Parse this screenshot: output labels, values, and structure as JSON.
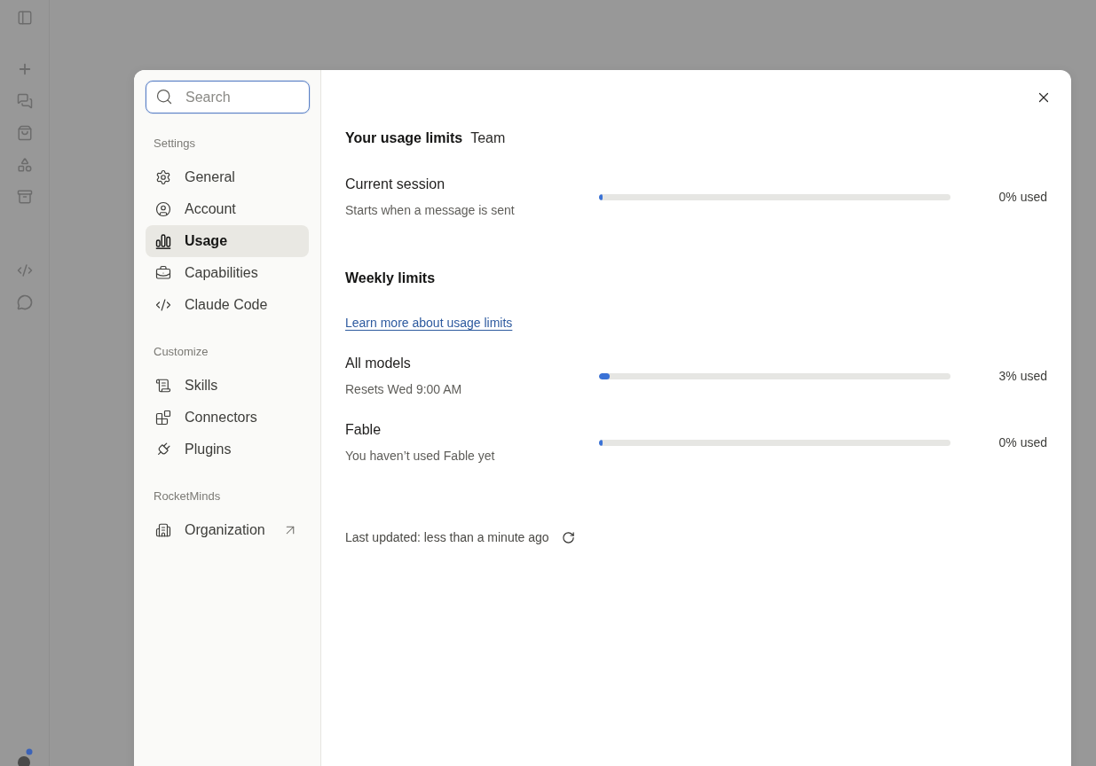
{
  "search": {
    "placeholder": "Search"
  },
  "sidebar": {
    "sections": [
      {
        "title": "Settings",
        "items": [
          {
            "label": "General",
            "selected": false,
            "external": false
          },
          {
            "label": "Account",
            "selected": false,
            "external": false
          },
          {
            "label": "Usage",
            "selected": true,
            "external": false
          },
          {
            "label": "Capabilities",
            "selected": false,
            "external": false
          },
          {
            "label": "Claude Code",
            "selected": false,
            "external": false
          }
        ]
      },
      {
        "title": "Customize",
        "items": [
          {
            "label": "Skills",
            "selected": false,
            "external": false
          },
          {
            "label": "Connectors",
            "selected": false,
            "external": false
          },
          {
            "label": "Plugins",
            "selected": false,
            "external": false
          }
        ]
      },
      {
        "title": "RocketMinds",
        "items": [
          {
            "label": "Organization",
            "selected": false,
            "external": true
          }
        ]
      }
    ]
  },
  "usage": {
    "title": "Your usage limits",
    "plan": "Team",
    "current_session": {
      "name": "Current session",
      "detail": "Starts when a message is sent",
      "level": 0,
      "reading": "0% used"
    },
    "weekly": {
      "title": "Weekly limits",
      "link": "Learn more about usage limits",
      "limits": [
        {
          "name": "All models",
          "detail": "Resets Wed 9:00 AM",
          "level": 0.03,
          "reading": "3% used"
        },
        {
          "name": "Fable",
          "detail": "You haven’t used Fable yet",
          "level": 0,
          "reading": "0% used"
        }
      ]
    },
    "last_updated": "Last updated: less than a minute ago"
  }
}
